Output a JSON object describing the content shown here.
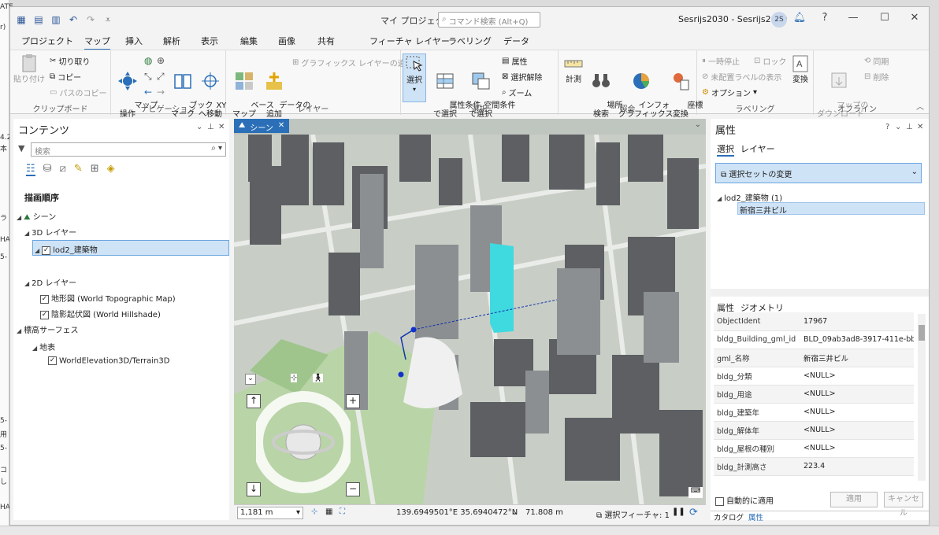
{
  "window": {
    "title": "マイ プロジェクト",
    "command_search_placeholder": "コマンド検索 (Alt+Q)",
    "user": "Sesrijs2030 - Sesrijs2030",
    "avatar_initials": "2S"
  },
  "menu_tabs": [
    "プロジェクト",
    "マップ",
    "挿入",
    "解析",
    "表示",
    "編集",
    "画像",
    "共有"
  ],
  "context_tabs": [
    "フィーチャ レイヤー",
    "ラベリング",
    "データ"
  ],
  "ribbon": {
    "clipboard": {
      "paste": "貼り付け",
      "cut": "切り取り",
      "copy": "コピー",
      "copy_path": "パスのコピー",
      "label": "クリップボード"
    },
    "navigation": {
      "map_ops": "マップ\n操作",
      "bookmarks": "ブック\nマーク",
      "xy": "XY\nへ移動",
      "label": "ナビゲーション"
    },
    "layer": {
      "basemap": "ベース\nマップ",
      "add_data": "データの\n追加",
      "add_graphics": "グラフィックス レイヤーの追加",
      "label": "レイヤー"
    },
    "selection": {
      "select": "選択",
      "by_attr": "属性条件\nで選択",
      "by_loc": "空間条件\nで選択",
      "attributes": "属性",
      "clear": "選択解除",
      "zoom": "ズーム",
      "label": "選択"
    },
    "inquiry": {
      "measure": "計測",
      "locate": "場所\n検索",
      "infographics": "インフォ\nグラフィックス",
      "coords": "座標\n変換",
      "label": "照会"
    },
    "labeling": {
      "pause": "一時停止",
      "lock": "ロック",
      "unplaced": "未配置ラベルの表示",
      "options": "オプション",
      "convert": "変換",
      "label": "ラベリング"
    },
    "offline": {
      "download": "マップの\nダウンロード",
      "sync": "同期",
      "remove": "削除",
      "label": "オフライン"
    }
  },
  "contents": {
    "title": "コンテンツ",
    "search_placeholder": "検索",
    "drawing_order": "描画順序",
    "tree": {
      "scene": "シーン",
      "layers3d": "3D レイヤー",
      "lod2": "lod2_建築物",
      "layers2d": "2D レイヤー",
      "topo": "地形図 (World Topographic Map)",
      "hillshade": "陰影起伏図 (World Hillshade)",
      "elevation": "標高サーフェス",
      "ground": "地表",
      "terrain": "WorldElevation3D/Terrain3D"
    }
  },
  "map": {
    "tab_label": "シーン",
    "scale": "1,181 m",
    "coords": "139.6949501°E 35.6940472°N",
    "elevation": "71.808 m",
    "selected_features": "選択フィーチャ: 1",
    "highlight_color": "#3fd9e0"
  },
  "attributes": {
    "title": "属性",
    "tabs": [
      "選択",
      "レイヤー"
    ],
    "dropdown": "選択セットの変更",
    "layer_node": "lod2_建築物 (1)",
    "selected_item": "新宿三井ビル",
    "sub_tabs": [
      "属性",
      "ジオメトリ"
    ],
    "rows": [
      {
        "field": "ObjectIdent",
        "value": "17967"
      },
      {
        "field": "bldg_Building_gml_id",
        "value": "BLD_09ab3ad8-3917-411e-bb9e"
      },
      {
        "field": "gml_名称",
        "value": "新宿三井ビル"
      },
      {
        "field": "bldg_分類",
        "value": "<NULL>"
      },
      {
        "field": "bldg_用途",
        "value": "<NULL>"
      },
      {
        "field": "bldg_建築年",
        "value": "<NULL>"
      },
      {
        "field": "bldg_解体年",
        "value": "<NULL>"
      },
      {
        "field": "bldg_屋根の種別",
        "value": "<NULL>"
      },
      {
        "field": "bldg_計測高さ",
        "value": "223.4"
      }
    ],
    "auto_apply": "自動的に適用",
    "apply": "適用",
    "cancel": "キャンセル",
    "bottom_tabs": [
      "カタログ",
      "属性"
    ]
  }
}
